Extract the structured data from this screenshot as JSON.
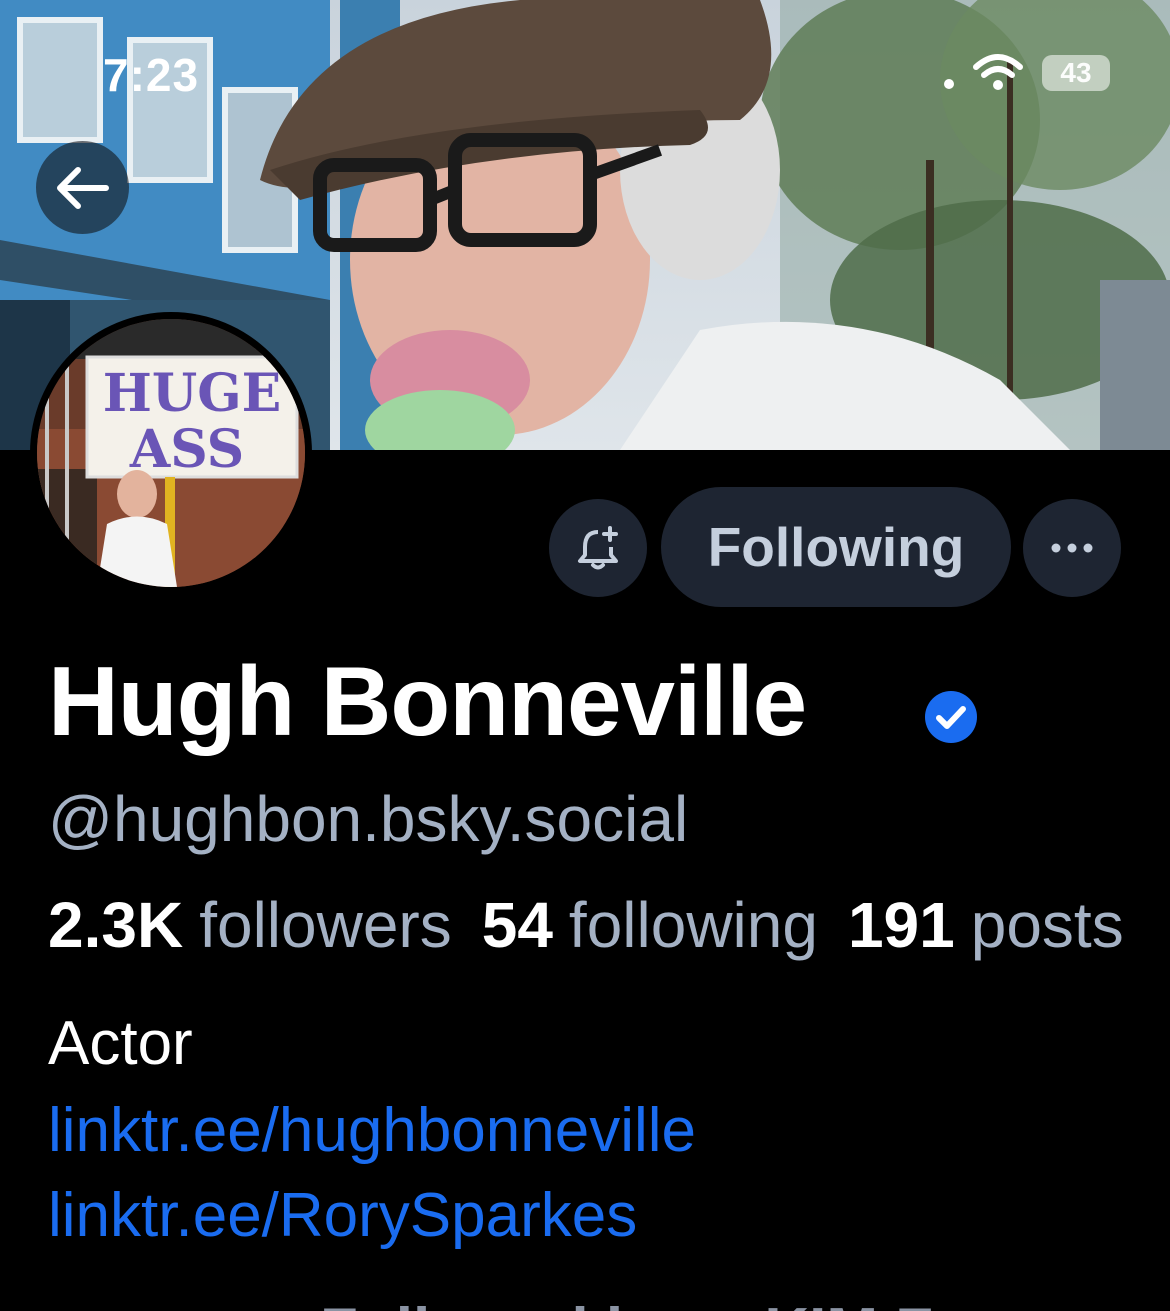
{
  "status_bar": {
    "time": "7:23",
    "battery": "43"
  },
  "profile": {
    "display_name": "Hugh Bonneville",
    "handle": "@hughbon.bsky.social",
    "stats": {
      "followers_count": "2.3K",
      "followers_label": "followers",
      "following_count": "54",
      "following_label": "following",
      "posts_count": "191",
      "posts_label": "posts"
    },
    "bio": {
      "text": "Actor",
      "links": [
        "linktr.ee/hughbonneville",
        "linktr.ee/RorySparkes"
      ]
    },
    "avatar_sign": {
      "line1": "HUGE",
      "line2": "ASS"
    }
  },
  "actions": {
    "following_label": "Following"
  },
  "followed_by": {
    "partial_text": "Followed by ... KIM F"
  },
  "colors": {
    "background": "#000000",
    "button_bg": "#1e2532",
    "link": "#1a6cf0",
    "muted_text": "#a4b1c4",
    "verified": "#1a6cf0"
  }
}
